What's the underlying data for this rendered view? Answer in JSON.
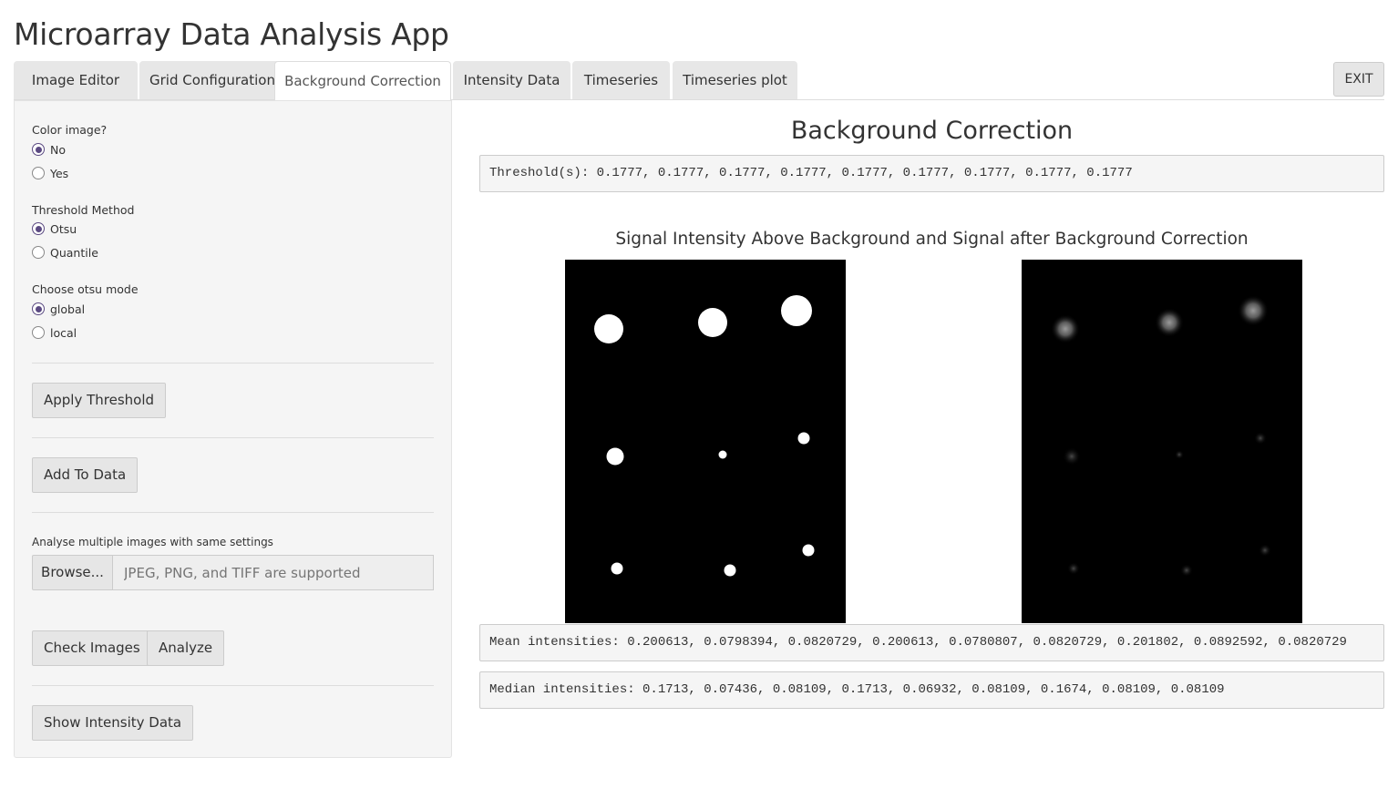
{
  "app": {
    "title": "Microarray Data Analysis App"
  },
  "tabs": [
    {
      "label": "Image Editor",
      "active": false
    },
    {
      "label": "Grid Configuration",
      "active": false
    },
    {
      "label": "Background Correction",
      "active": true
    },
    {
      "label": "Intensity Data",
      "active": false
    },
    {
      "label": "Timeseries",
      "active": false
    },
    {
      "label": "Timeseries plot",
      "active": false
    }
  ],
  "exit_label": "EXIT",
  "sidebar": {
    "color_image": {
      "label": "Color image?",
      "options": [
        "No",
        "Yes"
      ],
      "selected": "No"
    },
    "threshold_method": {
      "label": "Threshold Method",
      "options": [
        "Otsu",
        "Quantile"
      ],
      "selected": "Otsu"
    },
    "otsu_mode": {
      "label": "Choose otsu mode",
      "options": [
        "global",
        "local"
      ],
      "selected": "global"
    },
    "apply_threshold_label": "Apply Threshold",
    "add_to_data_label": "Add To Data",
    "multi_label": "Analyse multiple images with same settings",
    "browse_label": "Browse...",
    "file_placeholder": "JPEG, PNG, and TIFF are supported",
    "check_images_label": "Check Images",
    "analyze_label": "Analyze",
    "show_intensity_label": "Show Intensity Data"
  },
  "main": {
    "title": "Background Correction",
    "thresholds_text": "Threshold(s): 0.1777, 0.1777, 0.1777, 0.1777, 0.1777, 0.1777, 0.1777, 0.1777, 0.1777",
    "plot_title": "Signal Intensity Above Background and Signal after Background Correction",
    "mean_text": "Mean intensities: 0.200613, 0.0798394, 0.0820729, 0.200613, 0.0780807, 0.0820729, 0.201802, 0.0892592, 0.0820729",
    "median_text": "Median intensities: 0.1713, 0.07436, 0.08109, 0.1713, 0.06932, 0.08109, 0.1674, 0.08109, 0.08109"
  },
  "colors": {
    "accent": "#5b4a82",
    "sidebar_bg": "#f5f5f5",
    "tab_bg": "#e7e7e7"
  }
}
